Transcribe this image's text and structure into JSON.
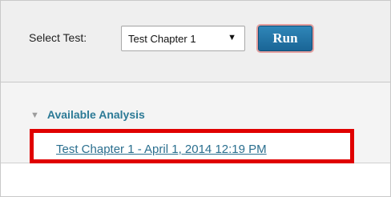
{
  "toolbar": {
    "select_label": "Select Test:",
    "selected_test": "Test Chapter 1",
    "caret_glyph": "▼",
    "run_label": "Run"
  },
  "analysis": {
    "heading": "Available Analysis",
    "toggle_glyph": "▼",
    "link_text": "Test Chapter 1 - April 1, 2014 12:19 PM"
  },
  "colors": {
    "link": "#2b6f8f",
    "heading": "#2c7a96",
    "run_button": "#1a6596",
    "highlight": "#e00000"
  }
}
